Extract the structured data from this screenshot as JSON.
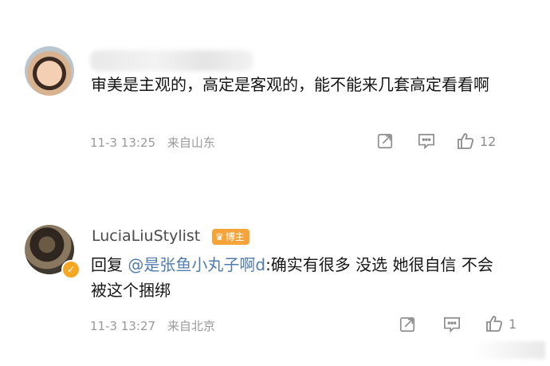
{
  "comments": [
    {
      "username": "",
      "text": "审美是主观的，高定是客观的，能不能来几套高定看看啊",
      "time": "11-3 13:25",
      "location": "来自山东",
      "like_count": "12",
      "icons": [
        "share-icon",
        "comment-icon",
        "like-icon"
      ]
    },
    {
      "username": "LuciaLiuStylist",
      "badge": "博主",
      "text_prefix": "回复 ",
      "mention": "@是张鱼小丸子啊d",
      "text_suffix": ":确实有很多 没选 她很自信 不会被这个捆绑",
      "time": "11-3 13:27",
      "location": "来自北京",
      "like_count": "1",
      "icons": [
        "share-icon",
        "comment-icon",
        "like-icon"
      ]
    }
  ],
  "colors": {
    "text": "#151515",
    "meta": "#9a9a9a",
    "mention": "#507daf",
    "badge": "#f6a43a"
  }
}
